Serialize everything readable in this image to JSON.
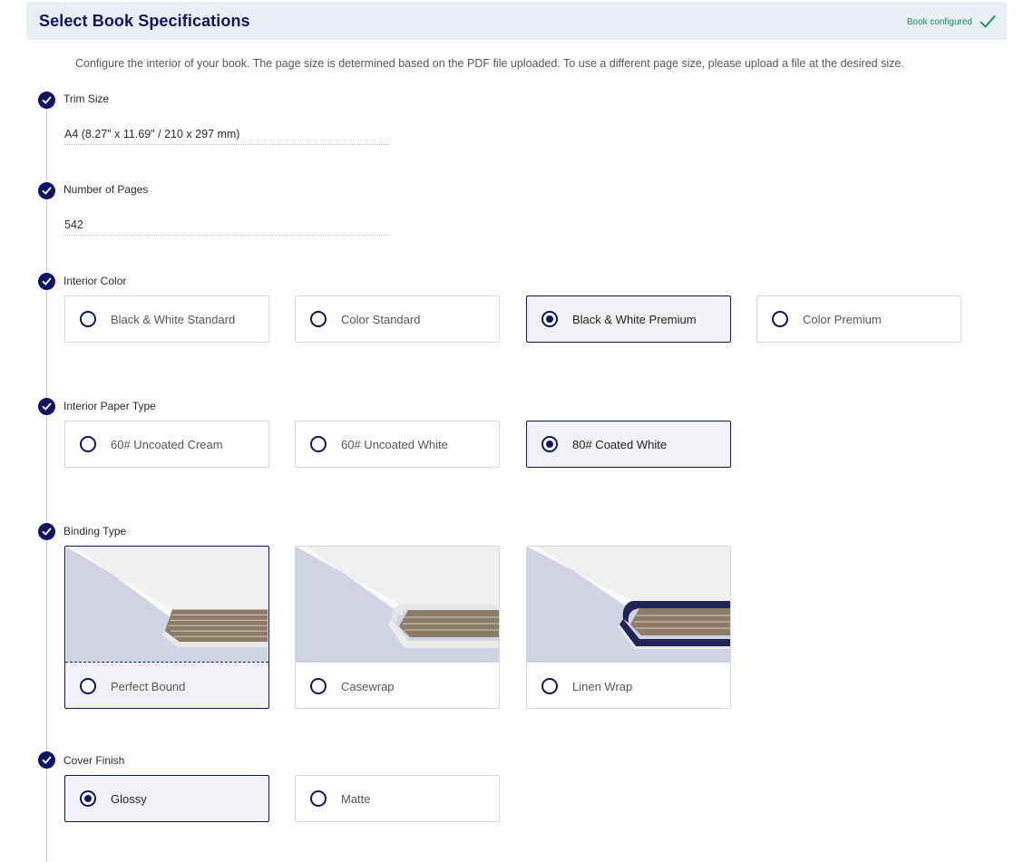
{
  "header": {
    "title": "Select Book Specifications",
    "status_text": "Book configured",
    "status_icon": "checkmark-icon",
    "status_color": "#0d8f5a"
  },
  "description": "Configure the interior of your book. The page size is determined based on the PDF file uploaded. To use a different page size, please upload a file at the desired size.",
  "colors": {
    "accent": "#0e1663",
    "selected_background": "#f1f2f8",
    "header_background": "#eaeef5"
  },
  "trim_size": {
    "label": "Trim Size",
    "value": "A4 (8.27\" x 11.69\" / 210 x 297 mm)"
  },
  "pages": {
    "label": "Number of Pages",
    "value": "542"
  },
  "interior_color": {
    "label": "Interior Color",
    "options": [
      {
        "label": "Black & White Standard",
        "selected": false
      },
      {
        "label": "Color Standard",
        "selected": false
      },
      {
        "label": "Black & White Premium",
        "selected": true
      },
      {
        "label": "Color Premium",
        "selected": false
      }
    ]
  },
  "paper_type": {
    "label": "Interior Paper Type",
    "options": [
      {
        "label": "60# Uncoated Cream",
        "selected": false
      },
      {
        "label": "60# Uncoated White",
        "selected": false
      },
      {
        "label": "80# Coated White",
        "selected": true
      }
    ]
  },
  "binding": {
    "label": "Binding Type",
    "options": [
      {
        "label": "Perfect Bound",
        "selected": true,
        "image": "perfect-bound-book-image"
      },
      {
        "label": "Casewrap",
        "selected": false,
        "image": "casewrap-book-image"
      },
      {
        "label": "Linen Wrap",
        "selected": false,
        "image": "linen-wrap-book-image"
      }
    ]
  },
  "cover_finish": {
    "label": "Cover Finish",
    "options": [
      {
        "label": "Glossy",
        "selected": true
      },
      {
        "label": "Matte",
        "selected": false
      }
    ]
  }
}
